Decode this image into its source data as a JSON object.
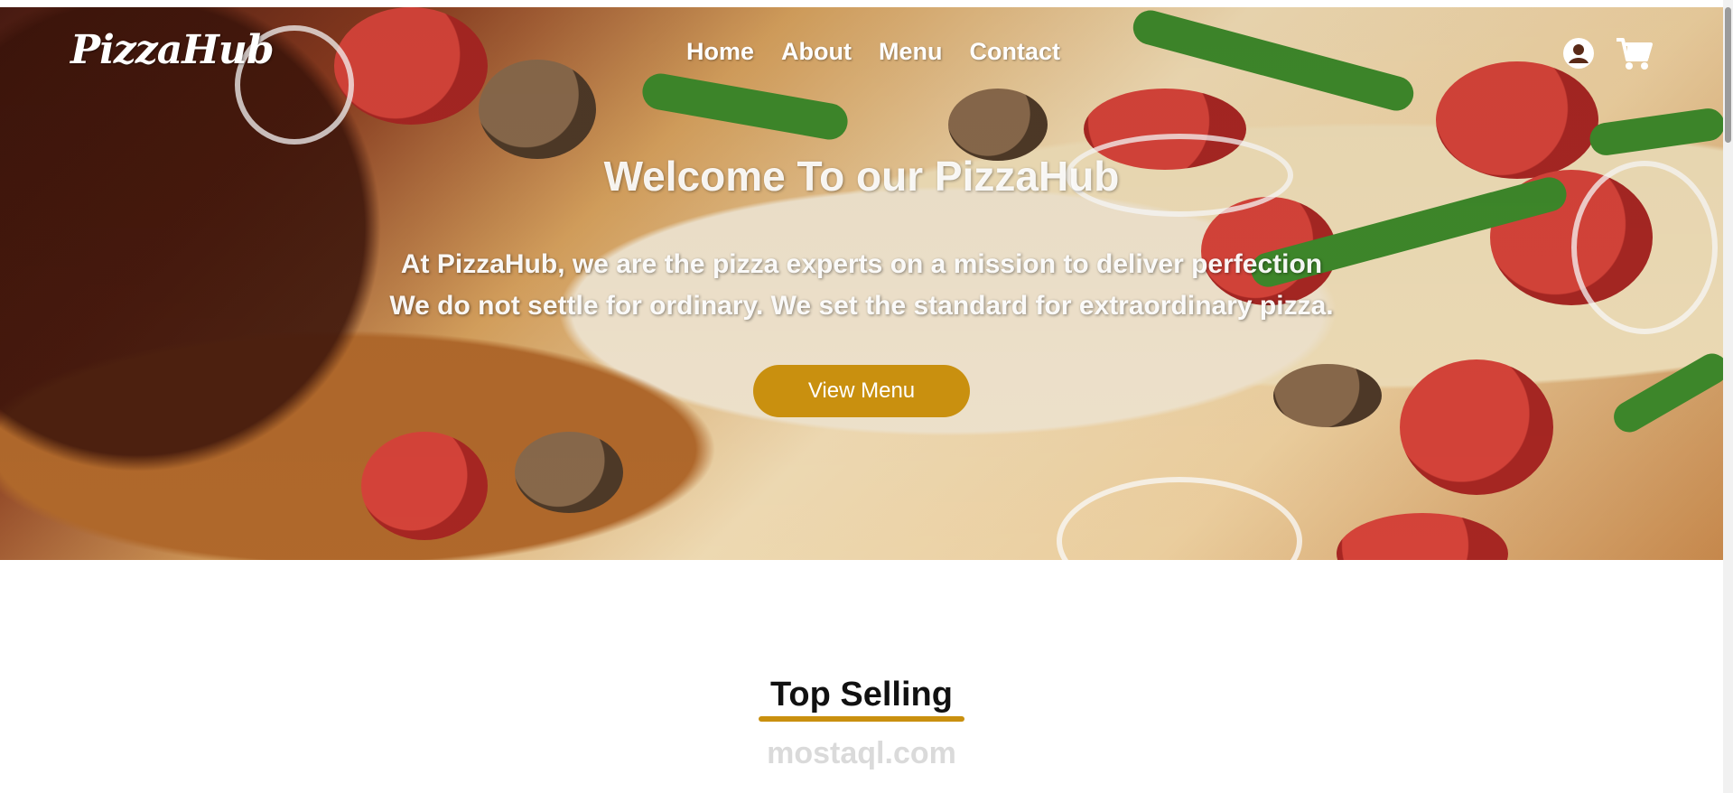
{
  "brand": {
    "logo": "PizzaHub"
  },
  "nav": {
    "items": [
      "Home",
      "About",
      "Menu",
      "Contact"
    ]
  },
  "header_icons": [
    "user-circle-icon",
    "cart-icon"
  ],
  "hero": {
    "title": "Welcome To our PizzaHub",
    "line1": "At PizzaHub, we are the pizza experts on a mission to deliver perfection",
    "line2": "We do not settle for ordinary. We set the standard for extraordinary pizza.",
    "cta": "View Menu"
  },
  "section": {
    "title": "Top Selling"
  },
  "watermark": {
    "text": "mostaql.com"
  },
  "colors": {
    "accent": "#c9900f",
    "text": "#111111",
    "hero_text": "#ffffff"
  }
}
